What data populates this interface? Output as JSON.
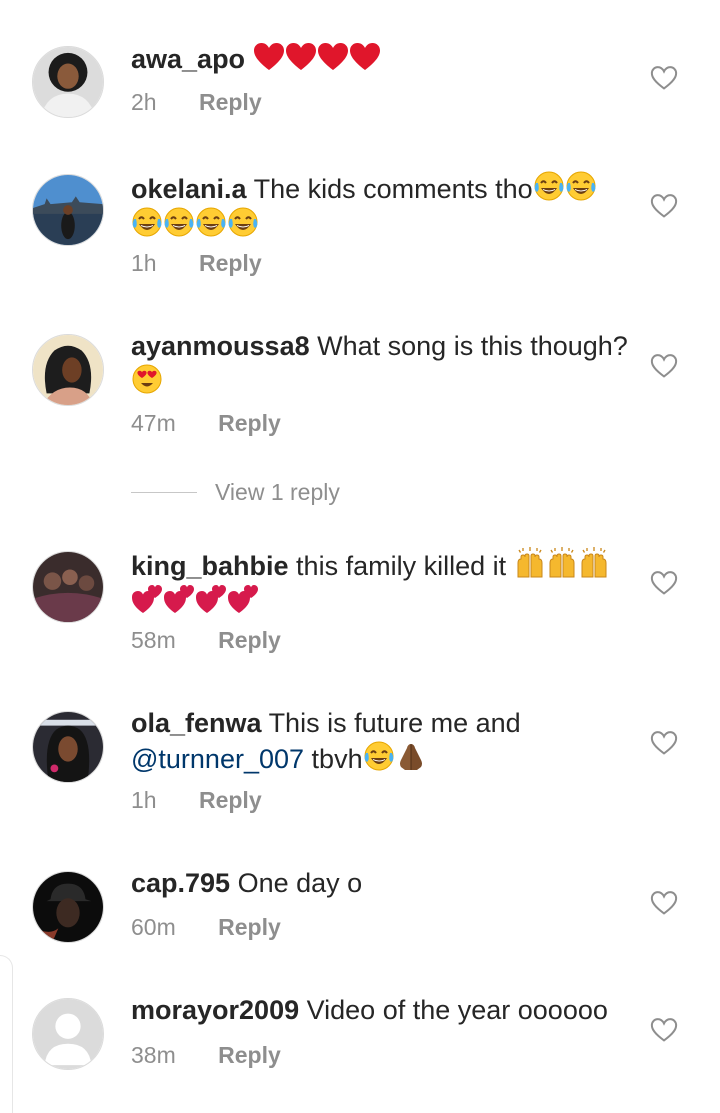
{
  "comments": [
    {
      "username": "awa_apo",
      "text": "",
      "time": "2h",
      "reply_label": "Reply",
      "emoji": [
        "red-heart",
        "red-heart",
        "red-heart",
        "red-heart"
      ]
    },
    {
      "username": "okelani.a",
      "text": "The kids comments tho",
      "time": "1h",
      "reply_label": "Reply",
      "emoji": [
        "face-with-tears-of-joy",
        "face-with-tears-of-joy",
        "face-with-tears-of-joy",
        "face-with-tears-of-joy",
        "face-with-tears-of-joy",
        "face-with-tears-of-joy"
      ]
    },
    {
      "username": "ayanmoussa8",
      "text": "What song is this though?",
      "time": "47m",
      "reply_label": "Reply",
      "emoji": [
        "smiling-face-with-heart-eyes"
      ]
    },
    {
      "username": "king_bahbie",
      "text": "this family killed it",
      "time": "58m",
      "reply_label": "Reply",
      "emoji": [
        "raising-hands",
        "raising-hands",
        "raising-hands",
        "two-hearts",
        "two-hearts",
        "two-hearts",
        "two-hearts"
      ]
    },
    {
      "username": "ola_fenwa",
      "text": "This is future me and",
      "mention": "@turnner_007",
      "text_after": "tbvh",
      "time": "1h",
      "reply_label": "Reply",
      "emoji": [
        "face-with-tears-of-joy",
        "folded-hands"
      ]
    },
    {
      "username": "cap.795",
      "text": "One day o",
      "time": "60m",
      "reply_label": "Reply",
      "emoji": []
    },
    {
      "username": "morayor2009",
      "text": "Video of the year oooooo",
      "time": "38m",
      "reply_label": "Reply",
      "emoji": []
    }
  ],
  "view_replies": {
    "label": "View 1 reply"
  },
  "colors": {
    "username": "#262626",
    "meta": "#8e8e8e",
    "mention": "#00376b",
    "heart_outline": "#8e8e8e",
    "emoji_heart": "#e0162b"
  }
}
